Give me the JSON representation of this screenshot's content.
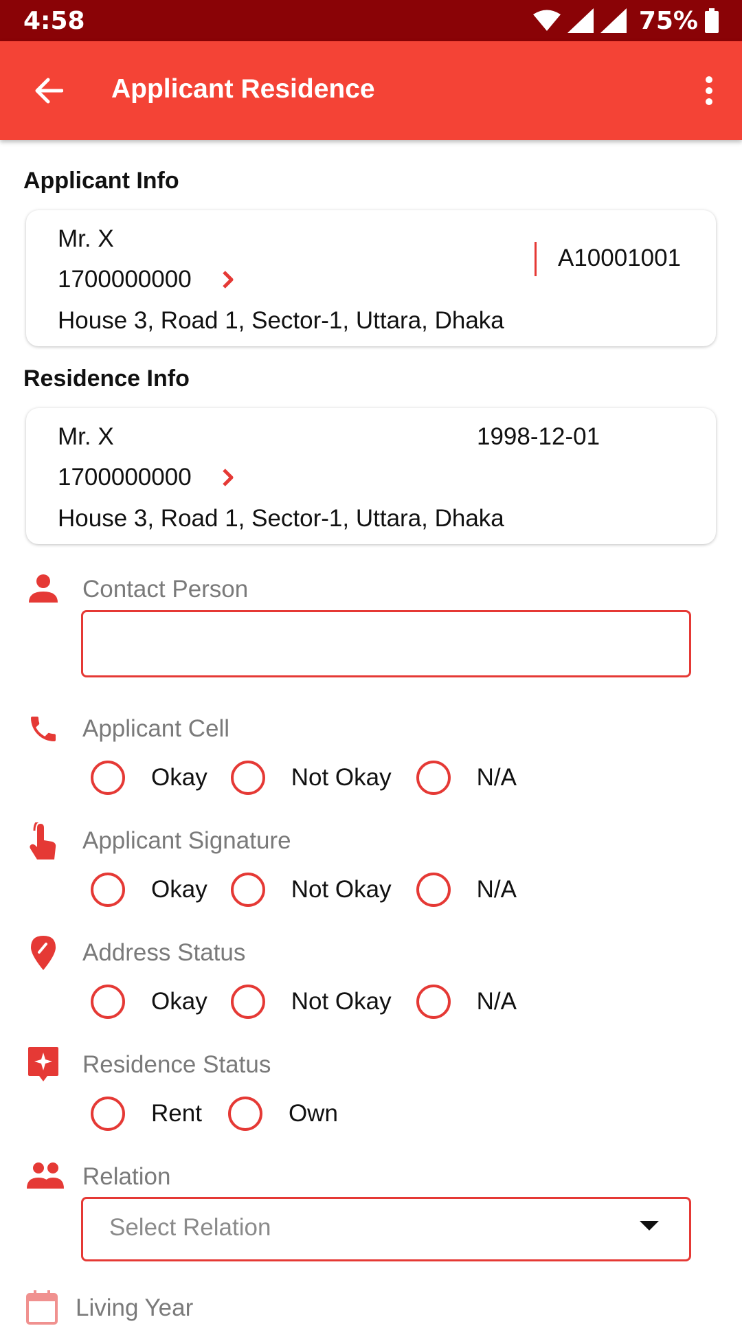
{
  "status_bar": {
    "time": "4:58",
    "battery": "75%"
  },
  "app_bar": {
    "title": "Applicant Residence",
    "back_icon": "arrow-back-icon",
    "more_icon": "more-vert-icon"
  },
  "applicant_info": {
    "title": "Applicant Info",
    "name": "Mr. X",
    "phone": "1700000000",
    "id": "A10001001",
    "address": "House 3, Road 1, Sector-1, Uttara, Dhaka"
  },
  "residence_info": {
    "title": "Residence Info",
    "name": "Mr. X",
    "date": "1998-12-01",
    "phone": "1700000000",
    "address": "House 3, Road 1, Sector-1, Uttara, Dhaka"
  },
  "form": {
    "contact_person": {
      "label": "Contact Person",
      "value": "",
      "icon": "person-icon"
    },
    "applicant_cell": {
      "label": "Applicant Cell",
      "icon": "phone-icon",
      "options": [
        "Okay",
        "Not Okay",
        "N/A"
      ]
    },
    "applicant_signature": {
      "label": "Applicant Signature",
      "icon": "touch-icon",
      "options": [
        "Okay",
        "Not Okay",
        "N/A"
      ]
    },
    "address_status": {
      "label": "Address Status",
      "icon": "location-pin-icon",
      "options": [
        "Okay",
        "Not Okay",
        "N/A"
      ]
    },
    "residence_status": {
      "label": "Residence Status",
      "icon": "sparkle-flag-icon",
      "options": [
        "Rent",
        "Own"
      ]
    },
    "relation": {
      "label": "Relation",
      "icon": "people-icon",
      "placeholder": "Select Relation"
    },
    "living_year": {
      "label": "Living Year",
      "icon": "calendar-icon"
    }
  },
  "colors": {
    "primary": "#f44336",
    "status_bar": "#8a0306",
    "accent": "#e53935"
  }
}
